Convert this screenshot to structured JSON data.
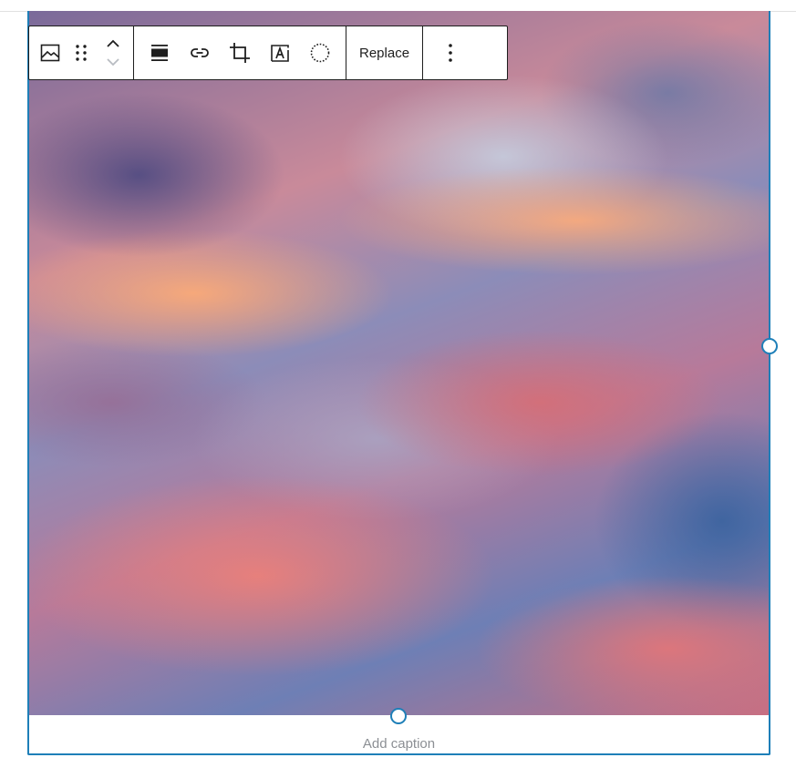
{
  "toolbar": {
    "buttons": [
      {
        "name": "image-block-icon",
        "label": "Image"
      },
      {
        "name": "drag-handle-icon",
        "label": "Drag"
      },
      {
        "name": "move-up-icon",
        "label": "Move up"
      },
      {
        "name": "move-down-icon",
        "label": "Move down"
      },
      {
        "name": "align-icon",
        "label": "Align"
      },
      {
        "name": "link-icon",
        "label": "Link"
      },
      {
        "name": "crop-icon",
        "label": "Crop"
      },
      {
        "name": "text-overlay-icon",
        "label": "Add text over image"
      },
      {
        "name": "duotone-icon",
        "label": "Apply duotone filter"
      },
      {
        "name": "more-options-icon",
        "label": "Options"
      }
    ],
    "replace_label": "Replace"
  },
  "image": {
    "description_icon": "sunset-clouds-photo"
  },
  "caption": {
    "placeholder": "Add caption"
  },
  "colors": {
    "accent": "#1e7fb8",
    "toolbar_border": "#1e1e1e",
    "caption_text": "#8c8f94"
  }
}
